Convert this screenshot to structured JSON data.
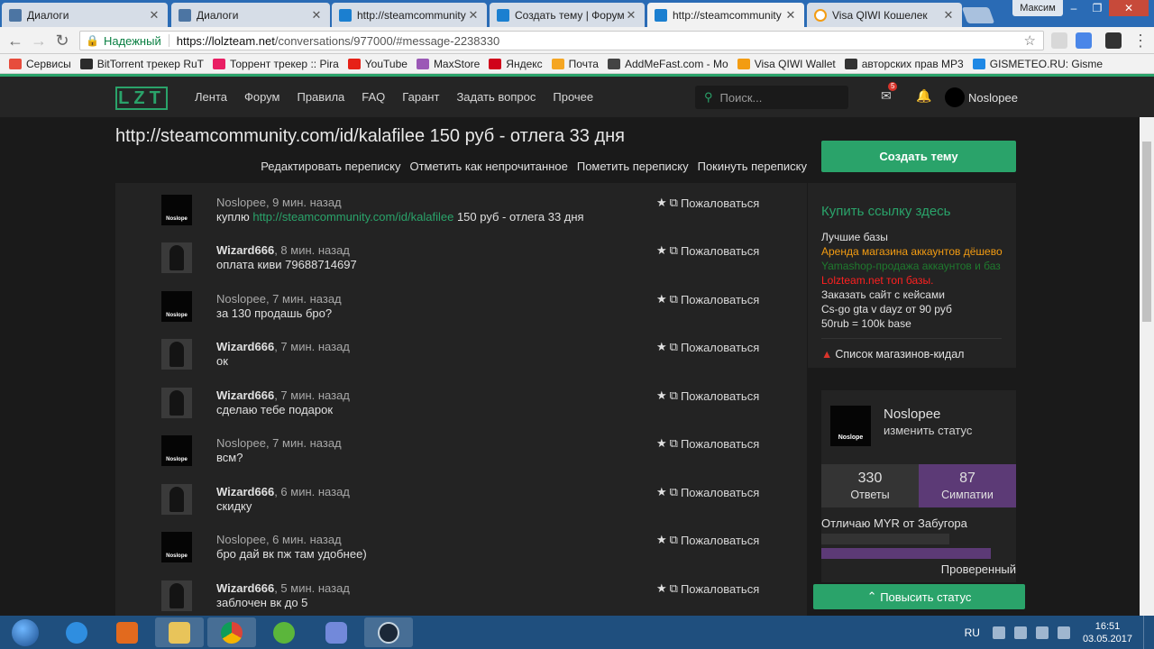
{
  "browser": {
    "tabs": [
      {
        "label": "Диалоги",
        "favicon": "vk-icon"
      },
      {
        "label": "Диалоги",
        "favicon": "vk-icon"
      },
      {
        "label": "http://steamcommunity",
        "favicon": "lolz-icon"
      },
      {
        "label": "Создать тему | Форум с",
        "favicon": "lolz-icon"
      },
      {
        "label": "http://steamcommunity",
        "favicon": "lolz-icon",
        "active": true
      },
      {
        "label": "Visa QIWI Кошелек",
        "favicon": "qiwi-icon"
      }
    ],
    "profile_name": "Максим",
    "secure_label": "Надежный",
    "url_host": "https://lolzteam.net",
    "url_path": "/conversations/977000/#message-2238330",
    "bookmarks": [
      {
        "label": "Сервисы",
        "color": "#e74c3c"
      },
      {
        "label": "BitTorrent трекер RuT",
        "color": "#2b2b2b"
      },
      {
        "label": "Торрент трекер :: Pira",
        "color": "#e91e63"
      },
      {
        "label": "YouTube",
        "color": "#e62117"
      },
      {
        "label": "MaxStore",
        "color": "#9b59b6"
      },
      {
        "label": "Яндекс",
        "color": "#d0021b"
      },
      {
        "label": "Почта",
        "color": "#f5a623"
      },
      {
        "label": "AddMeFast.com - Mo",
        "color": "#444444"
      },
      {
        "label": "Visa QIWI Wallet",
        "color": "#f39c12"
      },
      {
        "label": "авторских прав MP3",
        "color": "#333333"
      },
      {
        "label": "GISMETEO.RU: Gisme",
        "color": "#1e88e5"
      }
    ]
  },
  "header": {
    "logo_text": "LZT",
    "nav": [
      "Лента",
      "Форум",
      "Правила",
      "FAQ",
      "Гарант",
      "Задать вопрос",
      "Прочее"
    ],
    "search_placeholder": "Поиск...",
    "inbox_badge": "5",
    "username": "Noslopee",
    "accent": "#2aa36a"
  },
  "conversation": {
    "title": "http://steamcommunity.com/id/kalafilee 150 руб - отлега 33 дня",
    "actions": [
      "Редактировать переписку",
      "Отметить как непрочитанное",
      "Пометить переписку",
      "Покинуть переписку"
    ],
    "report_label": "Пожаловаться",
    "avatar_caption": "Noslope",
    "messages": [
      {
        "user": "Noslopee",
        "time": ", 9 мин. назад",
        "text_before": "куплю ",
        "link": "http://steamcommunity.com/id/kalafilee",
        "text_after": " 150 руб - отлега 33 дня"
      },
      {
        "user": "Wizard666",
        "time": ", 8 мин. назад",
        "text_before": "оплата киви 79688714697",
        "link": "",
        "text_after": ""
      },
      {
        "user": "Noslopee",
        "time": ", 7 мин. назад",
        "text_before": "за 130 продашь бро?",
        "link": "",
        "text_after": ""
      },
      {
        "user": "Wizard666",
        "time": ", 7 мин. назад",
        "text_before": "ок",
        "link": "",
        "text_after": ""
      },
      {
        "user": "Wizard666",
        "time": ", 7 мин. назад",
        "text_before": "сделаю тебе подарок",
        "link": "",
        "text_after": ""
      },
      {
        "user": "Noslopee",
        "time": ", 7 мин. назад",
        "text_before": "всм?",
        "link": "",
        "text_after": ""
      },
      {
        "user": "Wizard666",
        "time": ", 6 мин. назад",
        "text_before": "скидку",
        "link": "",
        "text_after": ""
      },
      {
        "user": "Noslopee",
        "time": ", 6 мин. назад",
        "text_before": "бро дай вк пж там удобнее)",
        "link": "",
        "text_after": ""
      },
      {
        "user": "Wizard666",
        "time": ", 5 мин. назад",
        "text_before": "заблочен вк до 5",
        "link": "",
        "text_after": ""
      }
    ]
  },
  "sidebar": {
    "create_button": "Создать тему",
    "ads_title": "Купить ссылку здесь",
    "ads": [
      {
        "text": "Лучшие базы",
        "color": "#e0e0e0"
      },
      {
        "text": "Аренда магазина аккаунтов дёшево",
        "color": "#f39c12"
      },
      {
        "text": "Yamashop-продажа аккаунтов и баз",
        "color": "#1f7a2e"
      },
      {
        "text": "Lolzteam.net топ базы.",
        "color": "#ff2020"
      },
      {
        "text": "Заказать сайт с кейсами",
        "color": "#e0e0e0"
      },
      {
        "text": "Cs-go gta v dayz от 90 руб",
        "color": "#e0e0e0"
      },
      {
        "text": "50rub = 100k base",
        "color": "#e0e0e0"
      }
    ],
    "scam_list": "Список магазинов-кидал",
    "profile": {
      "name": "Noslopee",
      "status_link": "изменить статус",
      "answers_count": "330",
      "answers_label": "Ответы",
      "likes_count": "87",
      "likes_label": "Симпатии",
      "note": "Отличаю MYR от Забугора",
      "verified": "Проверенный"
    },
    "raise_button": "Повысить статус"
  },
  "taskbar": {
    "lang": "RU",
    "time": "16:51",
    "date": "03.05.2017"
  }
}
